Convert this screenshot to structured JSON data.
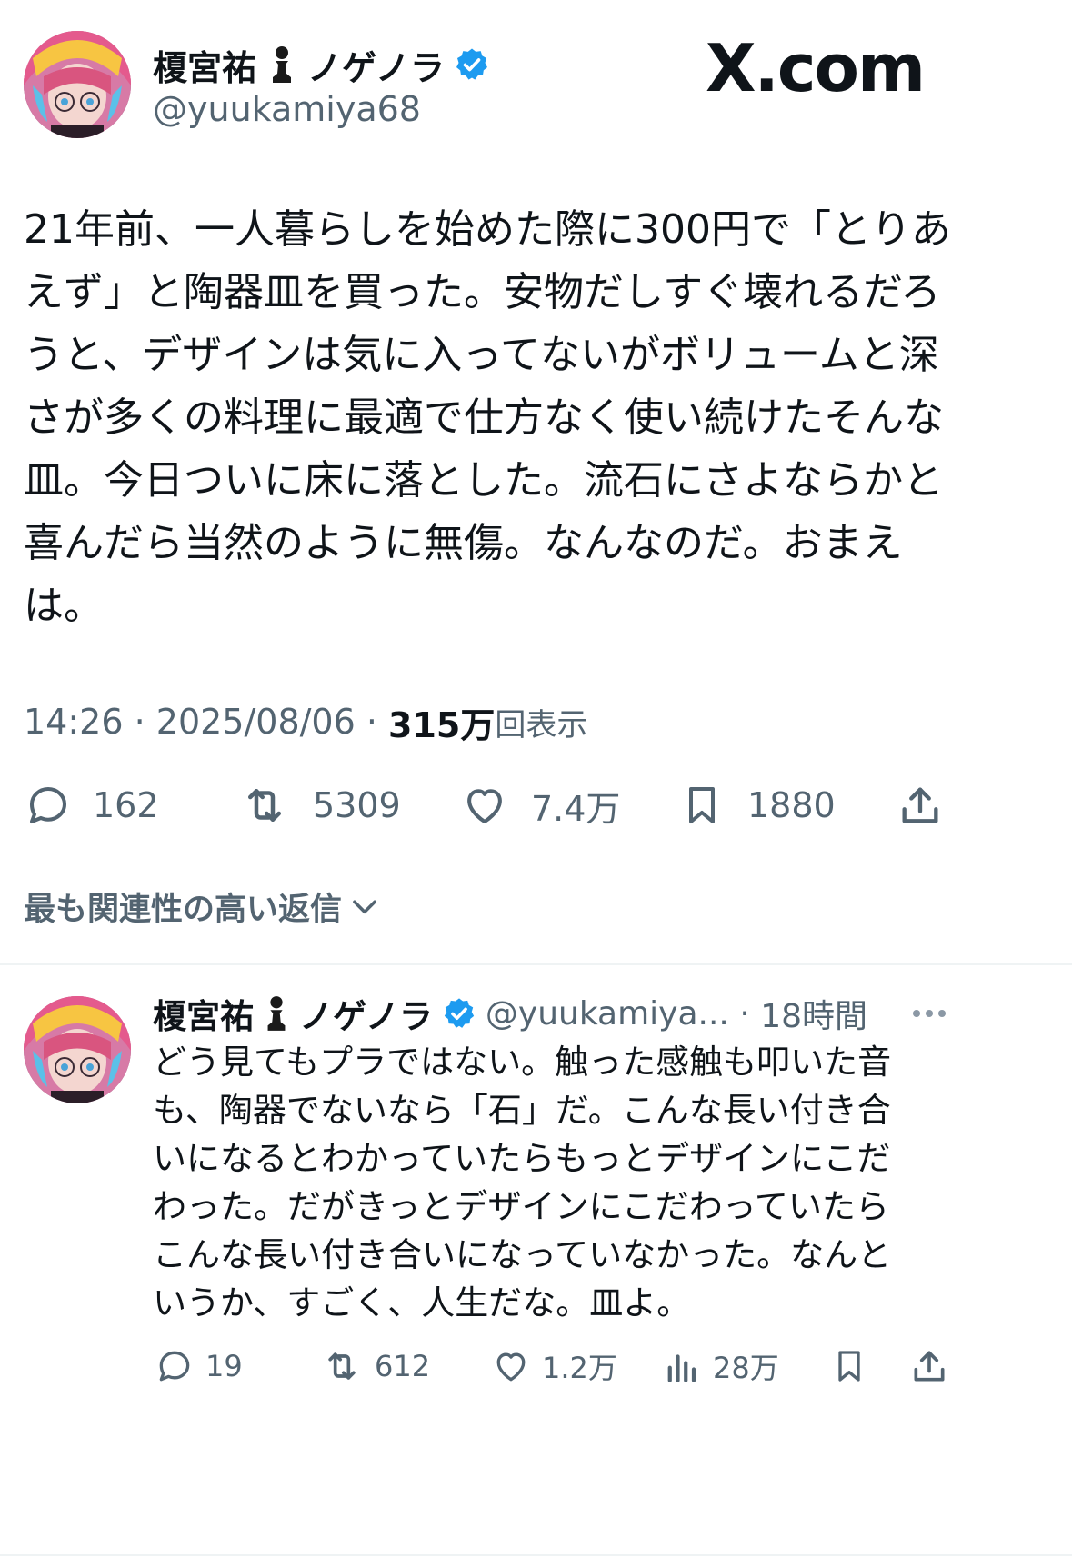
{
  "tweet": {
    "author_name": "榎宮祐",
    "author_name_suffix": "ノゲノラ",
    "handle": "@yuukamiya68",
    "logo": "X.com",
    "text": "21年前、一人暮らしを始めた際に300円で「とりあ\nえず」と陶器皿を買った。安物だしすぐ壊れるだろ\nうと、デザインは気に入ってないがボリュームと深\nさが多くの料理に最適で仕方なく使い続けたそんな\n皿。今日ついに床に落とした。流石にさよならかと\n喜んだら当然のように無傷。なんなのだ。おまえ\nは。",
    "time": "14:26",
    "date": "2025/08/06",
    "views_count": "315万",
    "views_label": "回表示",
    "replies": "162",
    "retweets": "5309",
    "likes": "7.4万",
    "bookmarks": "1880"
  },
  "replies_sort": {
    "label": "最も関連性の高い返信"
  },
  "reply": {
    "author_name": "榎宮祐",
    "author_name_suffix": "ノゲノラ",
    "handle": "@yuukamiya...",
    "time": "18時間",
    "text": "どう見てもプラではない。触った感触も叩いた音\nも、陶器でないなら「石」だ。こんな長い付き合\nいになるとわかっていたらもっとデザインにこだ\nわった。だがきっとデザインにこだわっていたら\nこんな長い付き合いになっていなかった。なんと\nいうか、すごく、人生だな。皿よ。",
    "replies": "19",
    "retweets": "612",
    "likes": "1.2万",
    "views": "28万"
  },
  "colors": {
    "text": "#0f1419",
    "secondary": "#536471",
    "verified": "#1d9bf0",
    "divider": "#eff3f4"
  },
  "icons": [
    "chess-pawn-icon",
    "verified-badge-icon",
    "reply-icon",
    "retweet-icon",
    "like-icon",
    "bookmark-icon",
    "share-icon",
    "views-icon",
    "more-icon",
    "chevron-down-icon"
  ]
}
